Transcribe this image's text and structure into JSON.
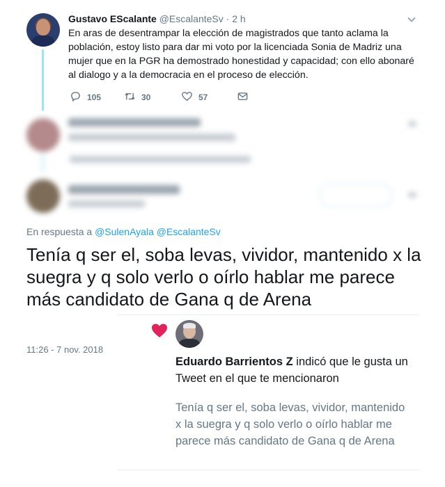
{
  "tweet": {
    "author_name": "Gustavo EScalante",
    "author_handle": "@EscalanteSv",
    "separator": "·",
    "time": "2 h",
    "text": "En aras de desentrampar la elección de magistrados que tanto aclama la población, estoy listo para dar mi voto por la licenciada Sonia de Madriz una mujer que en la PGR ha demostrado honestidad y capacidad; con ello abonaré al dialogo y a la democracia en el proceso de elección.",
    "replies": "105",
    "retweets": "30",
    "likes": "57",
    "icons": [
      "reply-icon",
      "retweet-icon",
      "heart-icon",
      "message-icon",
      "chevron-down-icon"
    ]
  },
  "reply": {
    "prefix": "En respuesta a",
    "mention1": "@SulenAyala",
    "mention2": "@EscalanteSv",
    "text": "Tenía q ser el,  soba levas, vividor, mantenido x la suegra y q solo verlo o oírlo hablar me parece más candidato de Gana q de Arena",
    "timestamp": "11:26 - 7 nov. 2018"
  },
  "notification": {
    "user": "Eduardo Barrientos Z",
    "action": " indicó que le gusta un Tweet en el que te mencionaron",
    "quote": "Tenía q ser el,  soba levas, vividor, mantenido x la suegra y q solo verlo o oírlo hablar me parece más candidato de Gana q de Arena",
    "heart_color": "#e0245e"
  },
  "colors": {
    "thread_line": "#9fe3f0",
    "mention": "#1da1f2",
    "secondary_text": "#657786"
  }
}
